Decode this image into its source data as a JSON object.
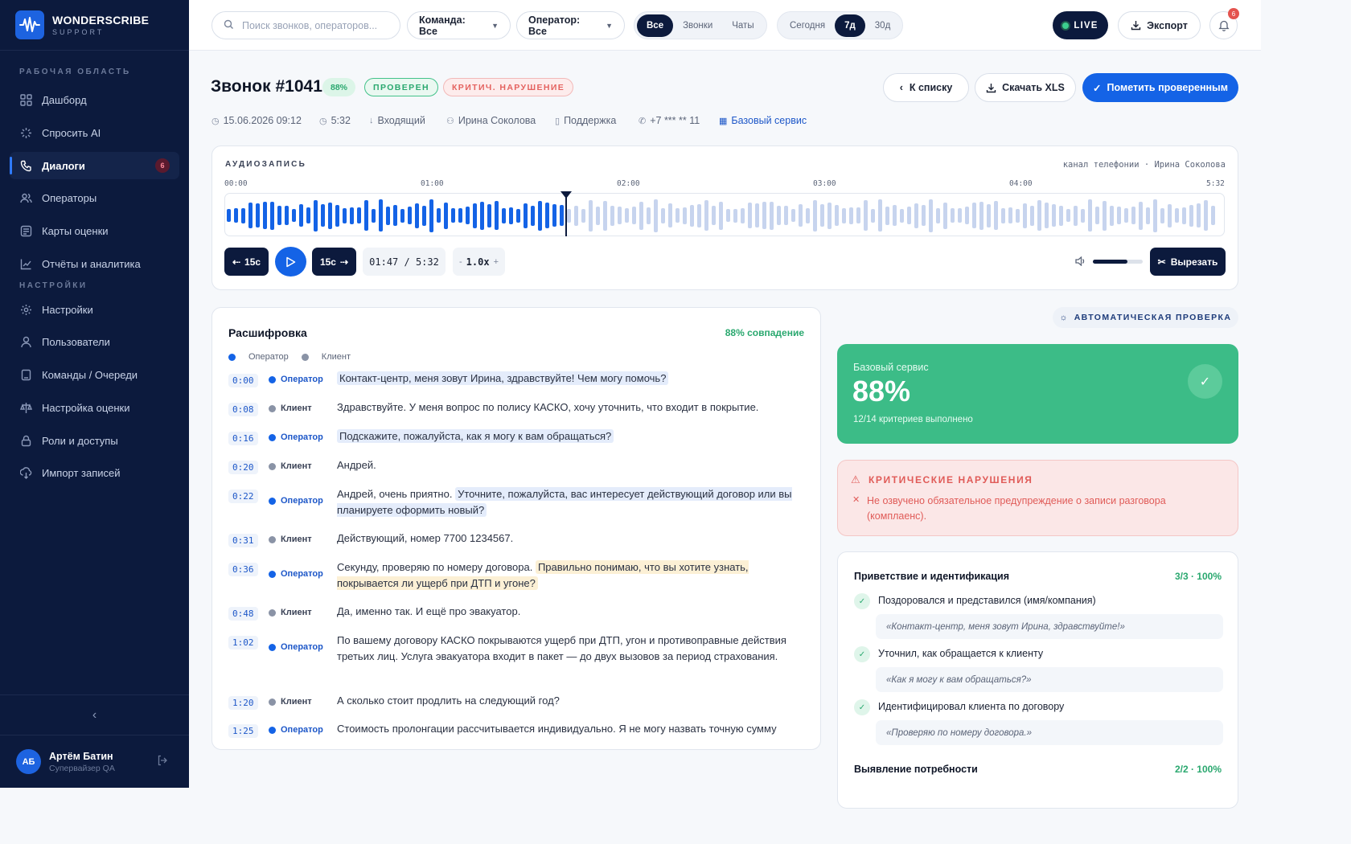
{
  "brand": {
    "name": "WONDERSCRIBE",
    "sub": "SUPPORT"
  },
  "sidebar": {
    "section_workspace": "РАБОЧАЯ ОБЛАСТЬ",
    "section_settings": "НАСТРОЙКИ",
    "items": [
      {
        "label": "Дашборд",
        "icon": "dashboard-icon"
      },
      {
        "label": "Спросить AI",
        "icon": "sparkle-icon"
      },
      {
        "label": "Диалоги",
        "icon": "phone-icon",
        "badge": "6",
        "active": true
      },
      {
        "label": "Операторы",
        "icon": "users-icon"
      },
      {
        "label": "Карты оценки",
        "icon": "scorecard-icon"
      },
      {
        "label": "Отчёты и аналитика",
        "icon": "chart-icon"
      },
      {
        "label": "Настройки",
        "icon": "gear-icon"
      },
      {
        "label": "Пользователи",
        "icon": "user-icon"
      },
      {
        "label": "Команды / Очереди",
        "icon": "queue-icon"
      },
      {
        "label": "Настройка оценки",
        "icon": "scale-icon"
      },
      {
        "label": "Роли и доступы",
        "icon": "lock-icon"
      },
      {
        "label": "Импорт записей",
        "icon": "import-icon"
      }
    ],
    "user": {
      "initials": "АБ",
      "name": "Артём Батин",
      "role": "Супервайзер QA"
    }
  },
  "topbar": {
    "search_placeholder": "Поиск звонков, операторов...",
    "team_filter": "Команда: Все",
    "operator_filter": "Оператор: Все",
    "type_tabs": [
      "Все",
      "Звонки",
      "Чаты"
    ],
    "type_active": "Все",
    "period_tabs": [
      "Сегодня",
      "7д",
      "30д"
    ],
    "period_active": "7д",
    "live_label": "LIVE",
    "export_label": "Экспорт",
    "notifications": "6"
  },
  "call": {
    "title": "Звонок #1041",
    "score_tag": "88%",
    "status_tag": "ПРОВЕРЕН",
    "critical_tag": "КРИТИЧ. НАРУШЕНИЕ",
    "back_label": "К списку",
    "xls_label": "Скачать XLS",
    "mark_label": "Пометить проверенным",
    "meta": {
      "datetime": "15.06.2026 09:12",
      "duration": "5:32",
      "direction": "Входящий",
      "operator": "Ирина Соколова",
      "queue": "Поддержка",
      "phone": "+7 *** ** 11",
      "scorecard": "Базовый сервис"
    }
  },
  "audio": {
    "title": "АУДИОЗАПИСЬ",
    "source": "канал телефонии · Ирина Соколова",
    "ticks": [
      "00:00",
      "01:00",
      "02:00",
      "03:00",
      "04:00",
      "5:32"
    ],
    "progress": 0.3408,
    "back_label": "15с",
    "fwd_label": "15с",
    "time": "01:47 / 5:32",
    "speed_minus": "-",
    "speed": "1.0x",
    "speed_plus": "+",
    "volume": 0.7,
    "cut_label": "Вырезать",
    "colors": {
      "played": "#1463e6",
      "remaining": "#c7d4ee"
    }
  },
  "transcript": {
    "title": "Расшифровка",
    "match": "88% совпадение",
    "legend_operator": "Оператор",
    "legend_client": "Клиент",
    "rows": [
      {
        "t": "0:00",
        "who": "Оператор",
        "pre": "",
        "hl": "Контакт-центр, меня зовут Ирина, здравствуйте! Чем могу помочь?",
        "hl_type": "b"
      },
      {
        "t": "0:08",
        "who": "Клиент",
        "pre": "Здравствуйте. У меня вопрос по полису КАСКО, хочу уточнить, что входит в покрытие.",
        "hl": "",
        "hl_type": ""
      },
      {
        "t": "0:16",
        "who": "Оператор",
        "pre": "",
        "hl": "Подскажите, пожалуйста, как я могу к вам обращаться?",
        "hl_type": "b"
      },
      {
        "t": "0:20",
        "who": "Клиент",
        "pre": "Андрей.",
        "hl": "",
        "hl_type": ""
      },
      {
        "t": "0:22",
        "who": "Оператор",
        "pre": "Андрей, очень приятно. ",
        "hl": "Уточните, пожалуйста, вас интересует действующий договор или вы планируете оформить новый?",
        "hl_type": "b"
      },
      {
        "t": "0:31",
        "who": "Клиент",
        "pre": "Действующий, номер 7700 1234567.",
        "hl": "",
        "hl_type": ""
      },
      {
        "t": "0:36",
        "who": "Оператор",
        "pre": "Секунду, проверяю по номеру договора. ",
        "hl": "Правильно понимаю, что вы хотите узнать, покрывается ли ущерб при ДТП и угоне?",
        "hl_type": "y"
      },
      {
        "t": "0:48",
        "who": "Клиент",
        "pre": "Да, именно так. И ещё про эвакуатор.",
        "hl": "",
        "hl_type": ""
      },
      {
        "t": "1:02",
        "who": "Оператор",
        "pre": "По вашему договору КАСКО покрываются ущерб при ДТП, угон и противоправные действия третьих лиц. Услуга эвакуатора входит в пакет — до двух вызовов за период страхования.",
        "hl": "",
        "hl_type": ""
      },
      {
        "t": "1:20",
        "who": "Клиент",
        "pre": "А сколько стоит продлить на следующий год?",
        "hl": "",
        "hl_type": ""
      },
      {
        "t": "1:25",
        "who": "Оператор",
        "pre": "Стоимость пролонгации рассчитывается индивидуально. Я не могу назвать точную сумму",
        "hl": "",
        "hl_type": ""
      }
    ]
  },
  "review": {
    "auto_label": "АВТОМАТИЧЕСКАЯ ПРОВЕРКА",
    "score_title": "Базовый сервис",
    "score_value": "88%",
    "score_sub": "12/14 критериев выполнено",
    "critical_title": "КРИТИЧЕСКИЕ НАРУШЕНИЯ",
    "critical_item": "Не озвучено обязательное предупреждение о записи разговора (комплаенс).",
    "groups": [
      {
        "title": "Приветствие и идентификация",
        "score": "3/3 · 100%",
        "items": [
          {
            "label": "Поздоровался и представился (имя/компания)",
            "quote": "«Контакт-центр, меня зовут Ирина, здравствуйте!»"
          },
          {
            "label": "Уточнил, как обращается к клиенту",
            "quote": "«Как я могу к вам обращаться?»"
          },
          {
            "label": "Идентифицировал клиента по договору",
            "quote": "«Проверяю по номеру договора.»"
          }
        ]
      },
      {
        "title": "Выявление потребности",
        "score": "2/2 · 100%"
      }
    ]
  }
}
